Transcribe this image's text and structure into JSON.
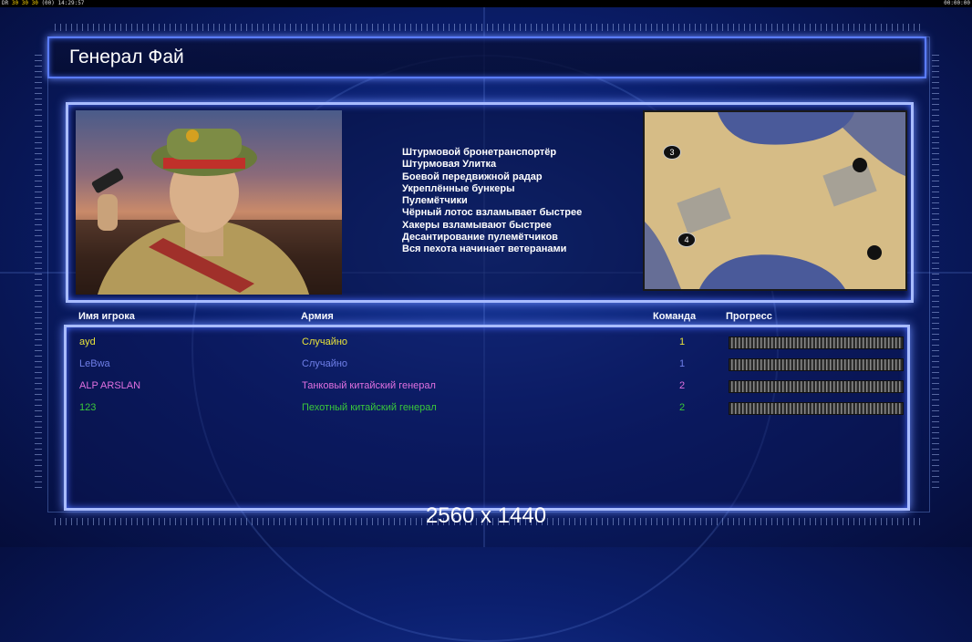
{
  "topbar": {
    "fps_a": "30",
    "fps_b": "30",
    "fps_c": "30",
    "extra": "(00)",
    "clock": "14:29:57",
    "timer": "00:00:00",
    "prefix": "DR"
  },
  "title": "Генерал Фай",
  "general": {
    "portrait": "general-portrait",
    "abilities": [
      "Штурмовой бронетранспортёр",
      "Штурмовая Улитка",
      "Боевой передвижной радар",
      "Укреплённые бункеры",
      "Пулемётчики",
      "Чёрный лотос взламывает быстрее",
      "Хакеры взламывают быстрее",
      "Десантирование пулемётчиков",
      "Вся пехота начинает ветеранами"
    ]
  },
  "minimap": {
    "start_positions": [
      "3",
      "4"
    ]
  },
  "table": {
    "headers": {
      "player": "Имя игрока",
      "army": "Армия",
      "team": "Команда",
      "progress": "Прогресс"
    },
    "rows": [
      {
        "player": "ayd",
        "army": "Случайно",
        "team": "1",
        "color": "#e8e23a",
        "progress": 0
      },
      {
        "player": "LeBwa",
        "army": "Случайно",
        "team": "1",
        "color": "#6f7fe8",
        "progress": 0
      },
      {
        "player": "ALP ARSLAN",
        "army": "Танковый китайский генерал",
        "team": "2",
        "color": "#e070e0",
        "progress": 0
      },
      {
        "player": "123",
        "army": "Пехотный китайский генерал",
        "team": "2",
        "color": "#3ac93a",
        "progress": 0
      }
    ]
  },
  "resolution_label": "2560 x 1440",
  "colors": {
    "panel_border": "#a9bcff",
    "background": "#0b1f6e"
  }
}
